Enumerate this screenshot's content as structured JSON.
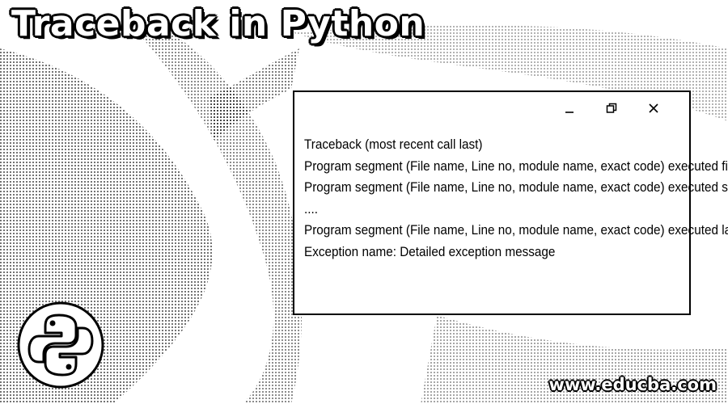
{
  "header": {
    "title": "Traceback in Python"
  },
  "window": {
    "controls": [
      {
        "name": "minimize",
        "icon": "minimize-icon"
      },
      {
        "name": "restore",
        "icon": "restore-icon"
      },
      {
        "name": "close",
        "icon": "close-icon"
      }
    ],
    "lines": [
      "Traceback (most recent call last)",
      "Program segment (File name, Line no, module name, exact code) executed first",
      "Program segment (File name, Line no, module name, exact code) executed second",
      "....",
      "Program segment (File name, Line no, module name, exact code) executed last",
      "Exception name: Detailed exception message"
    ]
  },
  "logo": {
    "icon": "python-logo-icon"
  },
  "footer": {
    "site": "www.educba.com"
  },
  "colors": {
    "ink": "#000000",
    "paper": "#ffffff",
    "background_pattern": "#bdbdbd"
  }
}
